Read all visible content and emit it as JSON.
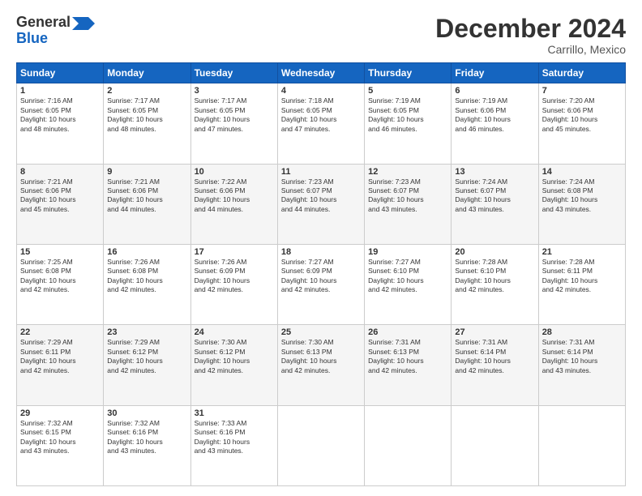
{
  "logo": {
    "line1": "General",
    "line2": "Blue"
  },
  "header": {
    "month": "December 2024",
    "location": "Carrillo, Mexico"
  },
  "weekdays": [
    "Sunday",
    "Monday",
    "Tuesday",
    "Wednesday",
    "Thursday",
    "Friday",
    "Saturday"
  ],
  "weeks": [
    [
      {
        "day": "1",
        "sunrise": "7:16 AM",
        "sunset": "6:05 PM",
        "daylight": "10 hours and 48 minutes."
      },
      {
        "day": "2",
        "sunrise": "7:17 AM",
        "sunset": "6:05 PM",
        "daylight": "10 hours and 48 minutes."
      },
      {
        "day": "3",
        "sunrise": "7:17 AM",
        "sunset": "6:05 PM",
        "daylight": "10 hours and 47 minutes."
      },
      {
        "day": "4",
        "sunrise": "7:18 AM",
        "sunset": "6:05 PM",
        "daylight": "10 hours and 47 minutes."
      },
      {
        "day": "5",
        "sunrise": "7:19 AM",
        "sunset": "6:05 PM",
        "daylight": "10 hours and 46 minutes."
      },
      {
        "day": "6",
        "sunrise": "7:19 AM",
        "sunset": "6:06 PM",
        "daylight": "10 hours and 46 minutes."
      },
      {
        "day": "7",
        "sunrise": "7:20 AM",
        "sunset": "6:06 PM",
        "daylight": "10 hours and 45 minutes."
      }
    ],
    [
      {
        "day": "8",
        "sunrise": "7:21 AM",
        "sunset": "6:06 PM",
        "daylight": "10 hours and 45 minutes."
      },
      {
        "day": "9",
        "sunrise": "7:21 AM",
        "sunset": "6:06 PM",
        "daylight": "10 hours and 44 minutes."
      },
      {
        "day": "10",
        "sunrise": "7:22 AM",
        "sunset": "6:06 PM",
        "daylight": "10 hours and 44 minutes."
      },
      {
        "day": "11",
        "sunrise": "7:23 AM",
        "sunset": "6:07 PM",
        "daylight": "10 hours and 44 minutes."
      },
      {
        "day": "12",
        "sunrise": "7:23 AM",
        "sunset": "6:07 PM",
        "daylight": "10 hours and 43 minutes."
      },
      {
        "day": "13",
        "sunrise": "7:24 AM",
        "sunset": "6:07 PM",
        "daylight": "10 hours and 43 minutes."
      },
      {
        "day": "14",
        "sunrise": "7:24 AM",
        "sunset": "6:08 PM",
        "daylight": "10 hours and 43 minutes."
      }
    ],
    [
      {
        "day": "15",
        "sunrise": "7:25 AM",
        "sunset": "6:08 PM",
        "daylight": "10 hours and 42 minutes."
      },
      {
        "day": "16",
        "sunrise": "7:26 AM",
        "sunset": "6:08 PM",
        "daylight": "10 hours and 42 minutes."
      },
      {
        "day": "17",
        "sunrise": "7:26 AM",
        "sunset": "6:09 PM",
        "daylight": "10 hours and 42 minutes."
      },
      {
        "day": "18",
        "sunrise": "7:27 AM",
        "sunset": "6:09 PM",
        "daylight": "10 hours and 42 minutes."
      },
      {
        "day": "19",
        "sunrise": "7:27 AM",
        "sunset": "6:10 PM",
        "daylight": "10 hours and 42 minutes."
      },
      {
        "day": "20",
        "sunrise": "7:28 AM",
        "sunset": "6:10 PM",
        "daylight": "10 hours and 42 minutes."
      },
      {
        "day": "21",
        "sunrise": "7:28 AM",
        "sunset": "6:11 PM",
        "daylight": "10 hours and 42 minutes."
      }
    ],
    [
      {
        "day": "22",
        "sunrise": "7:29 AM",
        "sunset": "6:11 PM",
        "daylight": "10 hours and 42 minutes."
      },
      {
        "day": "23",
        "sunrise": "7:29 AM",
        "sunset": "6:12 PM",
        "daylight": "10 hours and 42 minutes."
      },
      {
        "day": "24",
        "sunrise": "7:30 AM",
        "sunset": "6:12 PM",
        "daylight": "10 hours and 42 minutes."
      },
      {
        "day": "25",
        "sunrise": "7:30 AM",
        "sunset": "6:13 PM",
        "daylight": "10 hours and 42 minutes."
      },
      {
        "day": "26",
        "sunrise": "7:31 AM",
        "sunset": "6:13 PM",
        "daylight": "10 hours and 42 minutes."
      },
      {
        "day": "27",
        "sunrise": "7:31 AM",
        "sunset": "6:14 PM",
        "daylight": "10 hours and 42 minutes."
      },
      {
        "day": "28",
        "sunrise": "7:31 AM",
        "sunset": "6:14 PM",
        "daylight": "10 hours and 43 minutes."
      }
    ],
    [
      {
        "day": "29",
        "sunrise": "7:32 AM",
        "sunset": "6:15 PM",
        "daylight": "10 hours and 43 minutes."
      },
      {
        "day": "30",
        "sunrise": "7:32 AM",
        "sunset": "6:16 PM",
        "daylight": "10 hours and 43 minutes."
      },
      {
        "day": "31",
        "sunrise": "7:33 AM",
        "sunset": "6:16 PM",
        "daylight": "10 hours and 43 minutes."
      },
      null,
      null,
      null,
      null
    ]
  ]
}
